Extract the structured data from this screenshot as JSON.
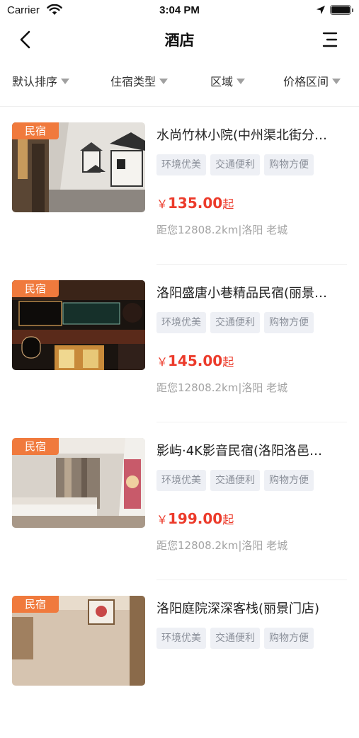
{
  "status_bar": {
    "carrier": "Carrier",
    "time": "3:04 PM"
  },
  "nav": {
    "title": "酒店",
    "back_icon": "chevron-left-icon",
    "menu_icon": "menu-icon"
  },
  "filters": [
    {
      "label": "默认排序"
    },
    {
      "label": "住宿类型"
    },
    {
      "label": "区域"
    },
    {
      "label": "价格区间"
    }
  ],
  "hotels": [
    {
      "badge": "民宿",
      "name": "水尚竹林小院(中州渠北街分…",
      "tags": [
        "环境优美",
        "交通便利",
        "购物方便"
      ],
      "currency": "￥",
      "price": "135.00",
      "price_suffix": "起",
      "distance": "距您12808.2km",
      "location": "洛阳 老城"
    },
    {
      "badge": "民宿",
      "name": "洛阳盛唐小巷精品民宿(丽景…",
      "tags": [
        "环境优美",
        "交通便利",
        "购物方便"
      ],
      "currency": "￥",
      "price": "145.00",
      "price_suffix": "起",
      "distance": "距您12808.2km",
      "location": "洛阳 老城"
    },
    {
      "badge": "民宿",
      "name": "影屿·4K影音民宿(洛阳洛邑…",
      "tags": [
        "环境优美",
        "交通便利",
        "购物方便"
      ],
      "currency": "￥",
      "price": "199.00",
      "price_suffix": "起",
      "distance": "距您12808.2km",
      "location": "洛阳 老城"
    },
    {
      "badge": "民宿",
      "name": "洛阳庭院深深客栈(丽景门店)",
      "tags": [
        "环境优美",
        "交通便利",
        "购物方便"
      ],
      "currency": "￥",
      "price": "",
      "price_suffix": "",
      "distance": "",
      "location": ""
    }
  ],
  "colors": {
    "accent": "#ec3b2b",
    "badge": "#f07a3d",
    "tag_bg": "#eef0f5",
    "tag_text": "#8a8f99"
  }
}
